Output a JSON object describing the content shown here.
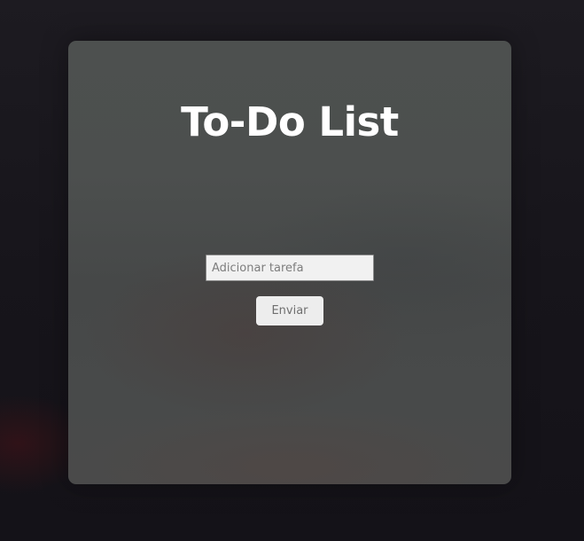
{
  "app": {
    "title": "To-Do List"
  },
  "form": {
    "task_input": {
      "value": "",
      "placeholder": "Adicionar tarefa"
    },
    "submit_label": "Enviar"
  },
  "colors": {
    "title_text": "#ffffff",
    "card_background": "#4b4e4d",
    "page_background": "#1b191f",
    "button_background": "#ededed",
    "button_text": "#6f6f6f",
    "input_background": "#f1f1f1"
  }
}
